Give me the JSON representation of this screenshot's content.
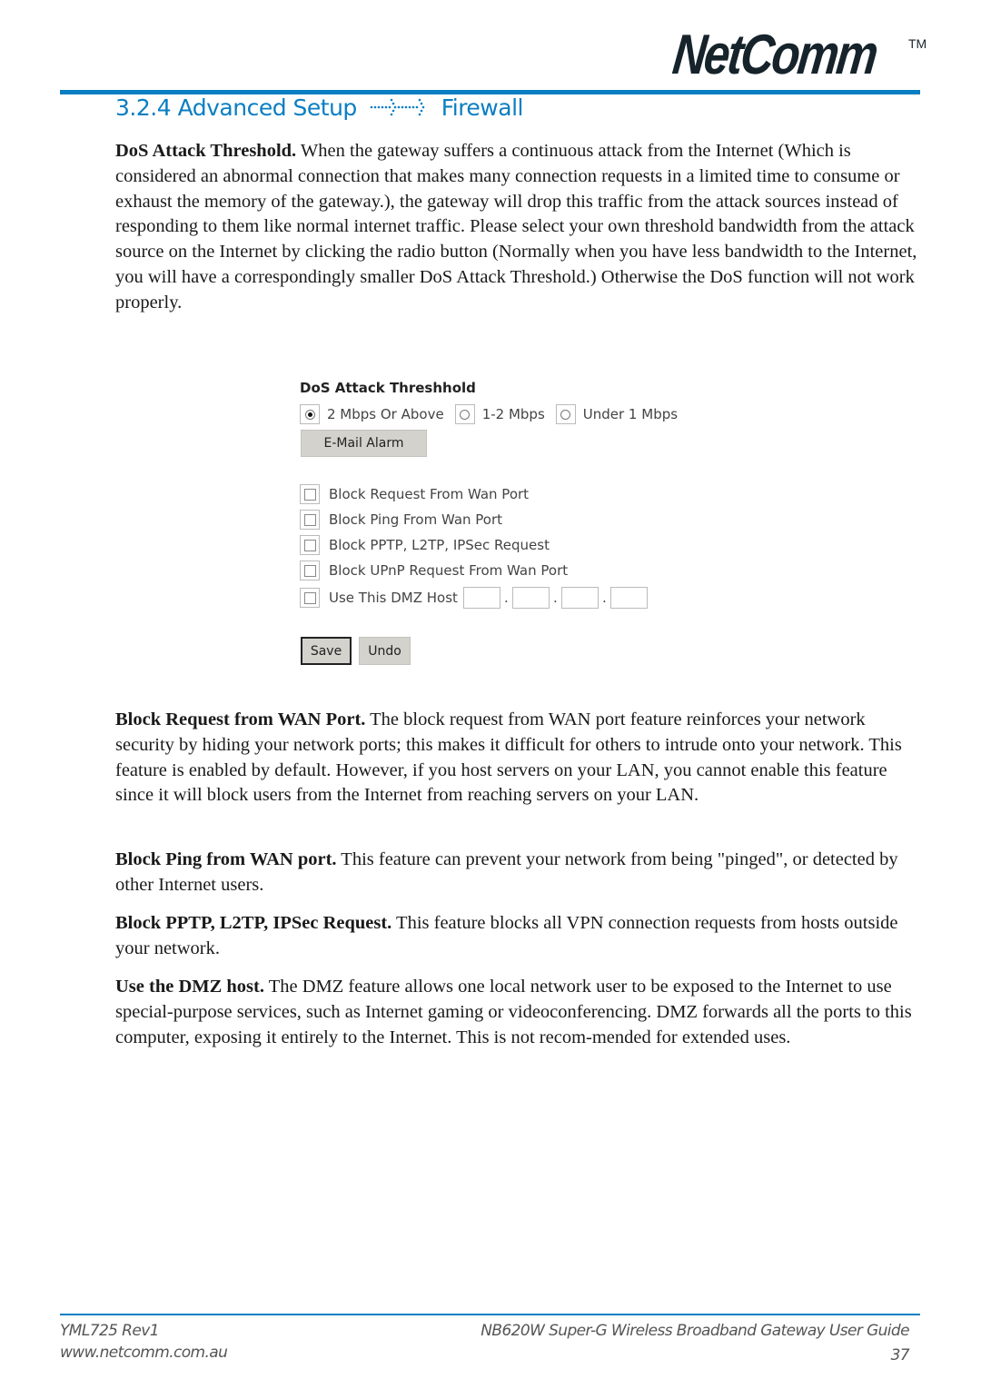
{
  "header": {
    "logo_text": "NetComm",
    "logo_tm": "TM",
    "section_number": "3.2.4",
    "breadcrumb": [
      "Advanced Setup",
      "Firewall"
    ],
    "breadcrumb_separator_icon": "dotted-arrow-icon",
    "accent_color": "#0a7ec2"
  },
  "intro": {
    "bold": "DoS Attack Threshold.",
    "text": " When the gateway suffers a continuous attack from the Internet (Which is considered an abnormal connection that makes many connection requests in a limited time to consume or exhaust the memory of the gateway.), the gateway will drop this traffic from the attack sources instead of responding to them like normal internet traffic. Please select your own threshold bandwidth from the attack source on the Internet by clicking the radio button (Normally when you have less bandwidth to the Internet, you will have a correspondingly smaller DoS Attack Threshold.) Otherwise the DoS function will not work properly."
  },
  "screenshot": {
    "title": "DoS Attack Threshhold",
    "radios": [
      {
        "label": "2 Mbps Or Above",
        "checked": true
      },
      {
        "label": "1-2 Mbps",
        "checked": false
      },
      {
        "label": "Under 1 Mbps",
        "checked": false
      }
    ],
    "email_alarm_label": "E-Mail Alarm",
    "checkboxes": [
      {
        "label": "Block Request From Wan Port",
        "checked": false
      },
      {
        "label": "Block Ping From Wan Port",
        "checked": false
      },
      {
        "label": "Block PPTP, L2TP, IPSec Request",
        "checked": false
      },
      {
        "label": "Block UPnP Request From Wan Port",
        "checked": false
      },
      {
        "label": "Use This DMZ Host",
        "checked": false
      }
    ],
    "dmz_ip": [
      "",
      "",
      "",
      ""
    ],
    "ip_separator": ".",
    "save_label": "Save",
    "undo_label": "Undo"
  },
  "sections": [
    {
      "bold": "Block Request from WAN Port.",
      "text": " The block request from WAN port feature reinforces your network security by hiding your network ports; this makes it difficult for others to intrude onto your network. This feature is enabled by default. However, if you host servers on your LAN, you cannot enable this feature since it will block users from the Internet from reaching servers on your LAN."
    },
    {
      "bold": "Block Ping from WAN port.",
      "text": " This feature can prevent your network from being \"pinged\", or detected by other Internet users."
    },
    {
      "bold": "Block PPTP, L2TP, IPSec Request.",
      "text": " This feature blocks all VPN connection requests from hosts outside your network."
    },
    {
      "bold": "Use the DMZ host.",
      "text": " The DMZ feature allows one local network user to be exposed to the Internet to use special-purpose services, such as Internet gaming or videoconferencing. DMZ forwards all the ports to this computer, exposing it entirely to the Internet. This is not recom-mended for extended uses."
    }
  ],
  "footer": {
    "doc_code": "YML725 Rev1",
    "website": "www.netcomm.com.au",
    "guide_title": "NB620W Super-G Wireless Broadband  Gateway User Guide",
    "page_number": "37"
  }
}
